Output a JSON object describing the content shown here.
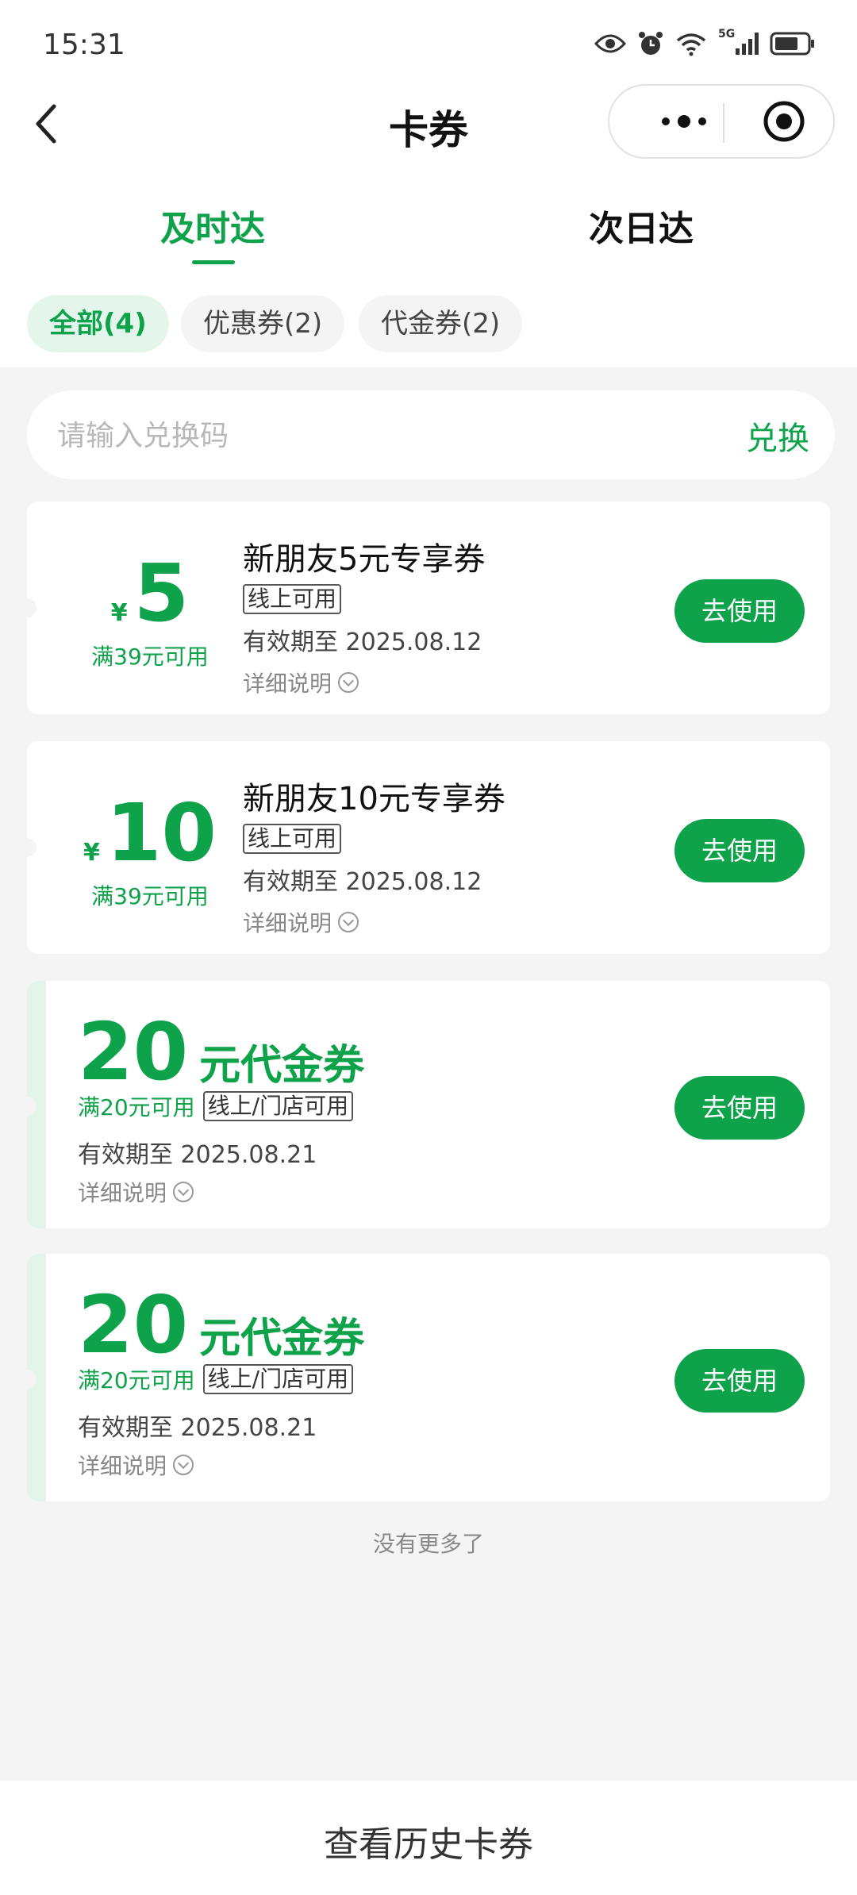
{
  "status_bar": {
    "time": "15:31",
    "icons": [
      "eye-icon",
      "alarm-icon",
      "wifi-icon",
      "signal-5g-icon",
      "battery-icon"
    ],
    "network_label": "5G"
  },
  "nav": {
    "title": "卡券",
    "back_icon": "chevron-left-icon",
    "capsule_icons": [
      "more-icon",
      "target-icon"
    ]
  },
  "delivery_tabs": [
    {
      "label": "及时达",
      "active": true
    },
    {
      "label": "次日达",
      "active": false
    }
  ],
  "filters": [
    {
      "label": "全部(4)",
      "active": true
    },
    {
      "label": "优惠券(2)",
      "active": false
    },
    {
      "label": "代金券(2)",
      "active": false
    }
  ],
  "redeem": {
    "placeholder": "请输入兑换码",
    "button": "兑换"
  },
  "coupons": [
    {
      "currency": "¥",
      "amount": "5",
      "condition": "满39元可用",
      "title": "新朋友5元专享券",
      "tag": "线上可用",
      "validity": "有效期至 2025.08.12",
      "detail": "详细说明",
      "action": "去使用"
    },
    {
      "currency": "¥",
      "amount": "10",
      "condition": "满39元可用",
      "title": "新朋友10元专享券",
      "tag": "线上可用",
      "validity": "有效期至 2025.08.12",
      "detail": "详细说明",
      "action": "去使用"
    }
  ],
  "vouchers": [
    {
      "amount": "20",
      "label": "元代金券",
      "condition": "满20元可用",
      "tag": "线上/门店可用",
      "validity": "有效期至 2025.08.21",
      "detail": "详细说明",
      "action": "去使用"
    },
    {
      "amount": "20",
      "label": "元代金券",
      "condition": "满20元可用",
      "tag": "线上/门店可用",
      "validity": "有效期至 2025.08.21",
      "detail": "详细说明",
      "action": "去使用"
    }
  ],
  "footer_note": "没有更多了",
  "bottom_button": "查看历史卡券",
  "colors": {
    "accent": "#0ea24b",
    "accent_light": "#e4f6eb",
    "background": "#f4f4f4"
  }
}
